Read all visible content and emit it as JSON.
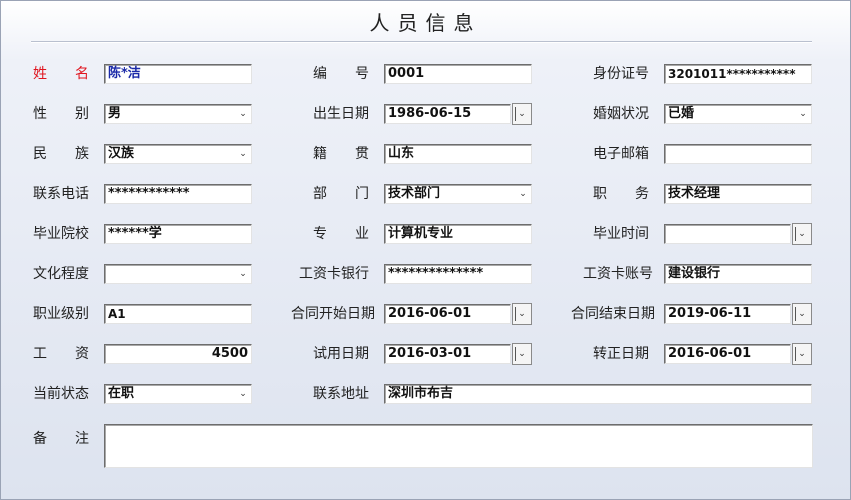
{
  "window": {
    "title": "人员信息"
  },
  "form": {
    "name": {
      "label": "姓　　名",
      "value": "陈*洁"
    },
    "code": {
      "label": "编　　号",
      "value": "0001"
    },
    "id_card": {
      "label": "身份证号",
      "value": "3201011***********"
    },
    "gender": {
      "label": "性　　别",
      "value": "男"
    },
    "birth_date": {
      "label": "出生日期",
      "value": "1986-06-15"
    },
    "marital": {
      "label": "婚姻状况",
      "value": "已婚"
    },
    "ethnicity": {
      "label": "民　　族",
      "value": "汉族"
    },
    "native_place": {
      "label": "籍　　贯",
      "value": "山东"
    },
    "email": {
      "label": "电子邮箱",
      "value": ""
    },
    "phone": {
      "label": "联系电话",
      "value": "************"
    },
    "department": {
      "label": "部　　门",
      "value": "技术部门"
    },
    "position": {
      "label": "职　　务",
      "value": "技术经理"
    },
    "school": {
      "label": "毕业院校",
      "value": "******学"
    },
    "major": {
      "label": "专　　业",
      "value": "计算机专业"
    },
    "grad_date": {
      "label": "毕业时间",
      "value": ""
    },
    "education": {
      "label": "文化程度",
      "value": ""
    },
    "salary_bank": {
      "label": "工资卡银行",
      "value": "**************"
    },
    "salary_account": {
      "label": "工资卡账号",
      "value": "建设银行"
    },
    "job_level": {
      "label": "职业级别",
      "value": "A1"
    },
    "contract_start": {
      "label": "合同开始日期",
      "value": "2016-06-01"
    },
    "contract_end": {
      "label": "合同结束日期",
      "value": "2019-06-11"
    },
    "salary": {
      "label": "工　　资",
      "value": "4500"
    },
    "probation_date": {
      "label": "试用日期",
      "value": "2016-03-01"
    },
    "regular_date": {
      "label": "转正日期",
      "value": "2016-06-01"
    },
    "status": {
      "label": "当前状态",
      "value": "在职"
    },
    "address": {
      "label": "联系地址",
      "value": "深圳市布吉"
    },
    "remarks": {
      "label": "备　　注",
      "value": ""
    }
  },
  "icons": {
    "dropdown": "chevron-down-icon",
    "date_picker": "spin-icon"
  }
}
